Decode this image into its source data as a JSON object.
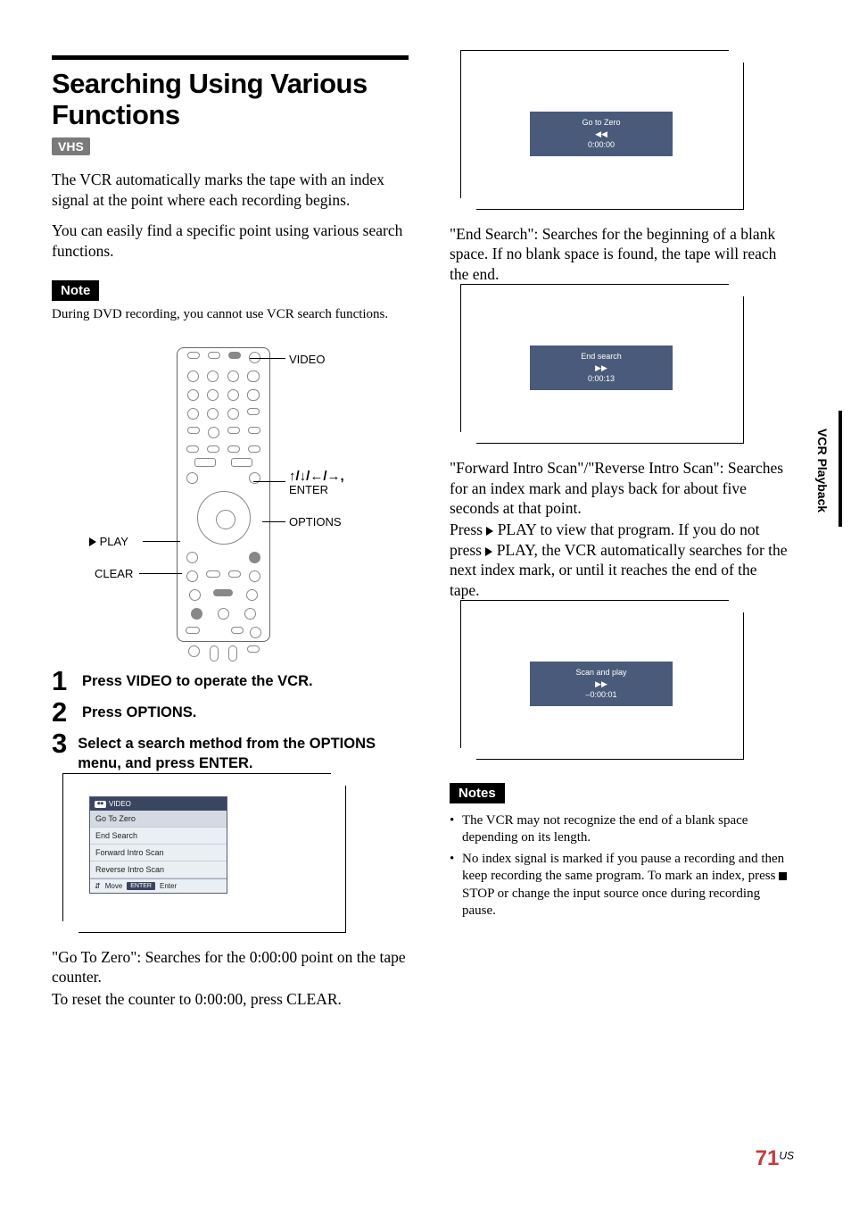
{
  "title": "Searching Using Various Functions",
  "vhs_badge": "VHS",
  "intro_p1": "The VCR automatically marks the tape with an index signal at the point where each recording begins.",
  "intro_p2": "You can easily find a specific point using various search functions.",
  "note_label": "Note",
  "note_text": "During DVD recording, you cannot use VCR search functions.",
  "remote_labels": {
    "video": "VIDEO",
    "arrows_enter_line1": "M/m/</,,",
    "arrows_enter_line2": "ENTER",
    "options": "OPTIONS",
    "play": "H PLAY",
    "clear": "CLEAR"
  },
  "steps": {
    "s1": "Press VIDEO to operate the VCR.",
    "s2": "Press OPTIONS.",
    "s3": "Select a search method from the OPTIONS menu, and press ENTER."
  },
  "options_menu": {
    "header_icon": "⏺⏺",
    "header_label": "VIDEO",
    "items": [
      "Go To Zero",
      "End Search",
      "Forward Intro Scan",
      "Reverse Intro Scan"
    ],
    "footer_move": "Move",
    "footer_enter_key": "ENTER",
    "footer_enter": "Enter"
  },
  "goto_zero_desc_l1": "\"Go To Zero\": Searches for the 0:00:00 point on the tape counter.",
  "goto_zero_desc_l2": "To reset the counter to 0:00:00, press CLEAR.",
  "osd_goto": {
    "title": "Go to Zero",
    "arrows": "◀◀",
    "time": "0:00:00"
  },
  "end_search_desc": "\"End Search\": Searches for the beginning of a blank space. If no blank space is found, the tape will reach the end.",
  "osd_end": {
    "title": "End search",
    "arrows": "▶▶",
    "time": "0:00:13"
  },
  "intro_scan_p1": "\"Forward Intro Scan\"/\"Reverse Intro Scan\": Searches for an index mark and plays back for about five seconds at that point.",
  "intro_scan_p2a": "Press ",
  "intro_scan_p2b": " PLAY to view that program. If you do not press ",
  "intro_scan_p2c": " PLAY, the VCR automatically searches for the next index mark, or until it reaches the end of the tape.",
  "osd_scan": {
    "title": "Scan and play",
    "arrows": "▶▶",
    "time": "–0:00:01"
  },
  "notes_label": "Notes",
  "notes": {
    "n1": "The VCR may not recognize the end of a blank space depending on its length.",
    "n2a": "No index signal is marked if you pause a recording and then keep recording the same program. To mark an index, press ",
    "n2b": " STOP or change the input source once during recording pause."
  },
  "side_tab": "VCR Playback",
  "page_number": "71",
  "page_suffix": "US"
}
